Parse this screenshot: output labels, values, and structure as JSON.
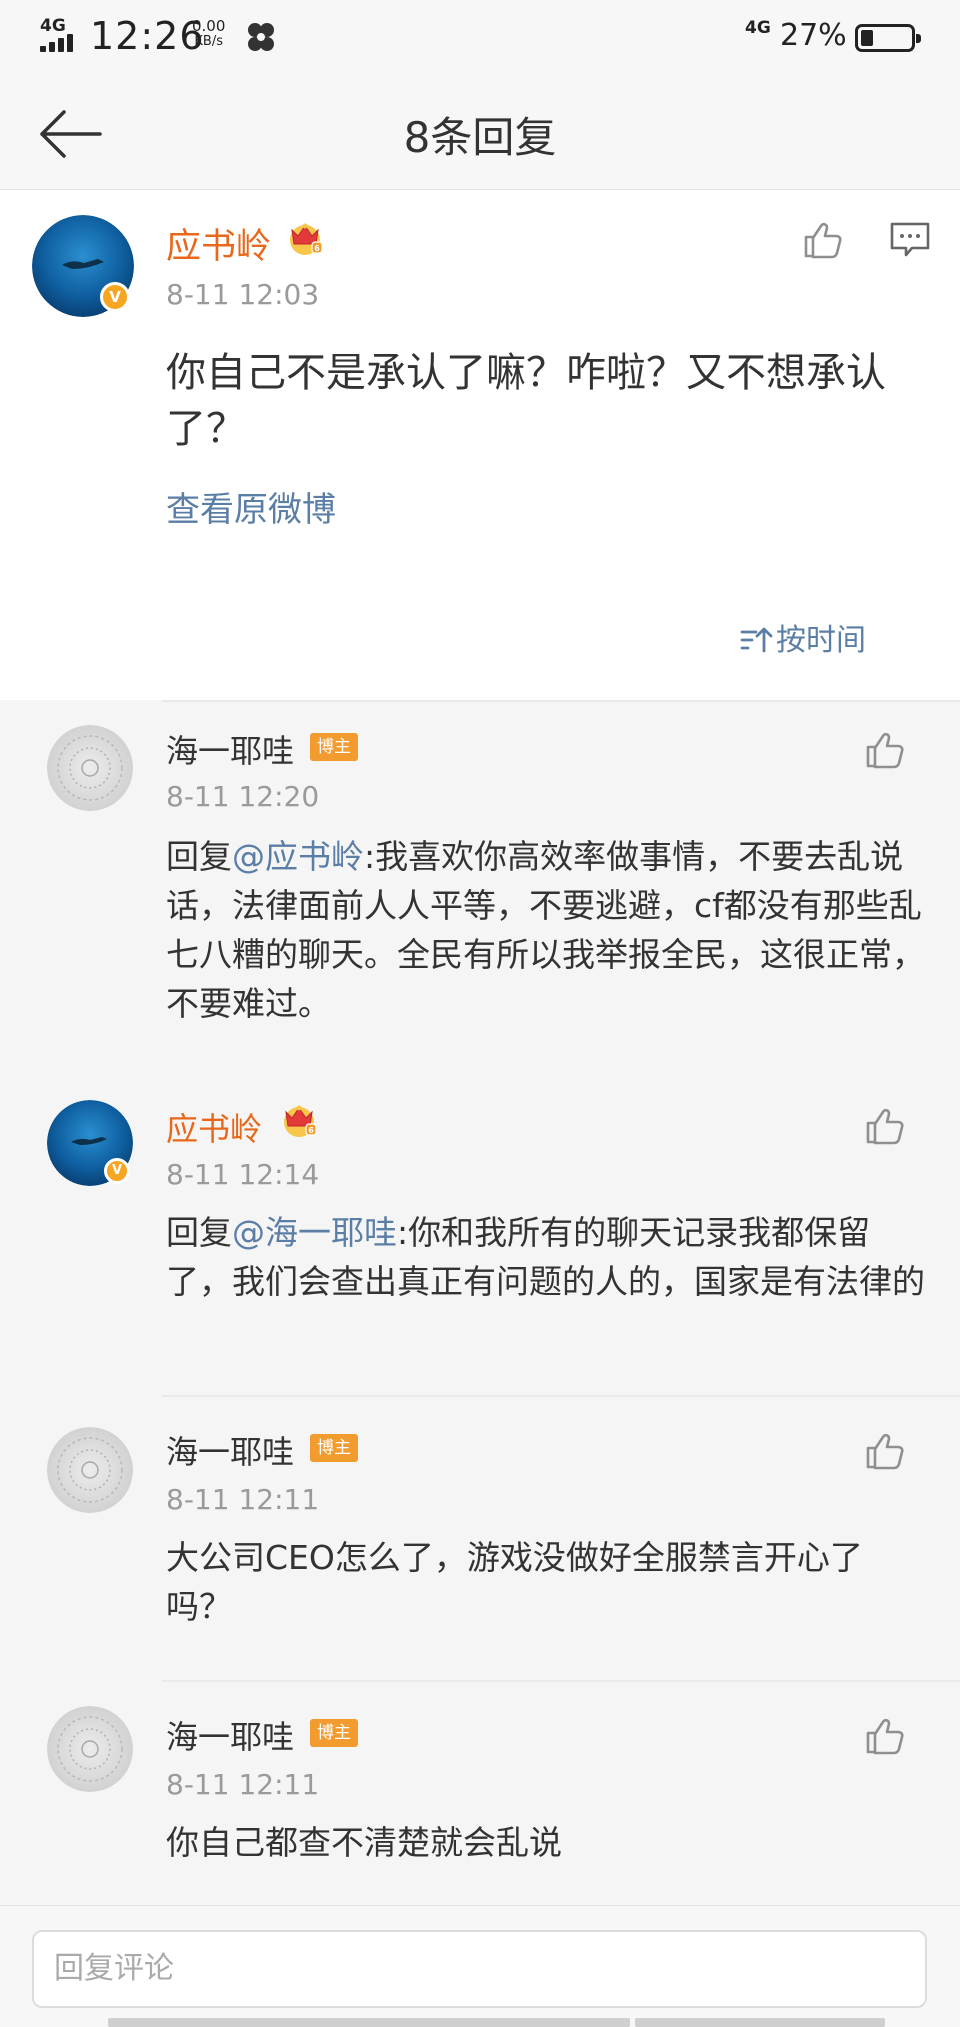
{
  "status_bar": {
    "network_left": "4G",
    "time": "12:26",
    "speed_value": "0.00",
    "speed_unit": "KB/s",
    "network_right": "4G",
    "battery_percent": "27%",
    "battery_level": 0.27
  },
  "header": {
    "title": "8条回复"
  },
  "main_comment": {
    "author": "应书岭",
    "verified_badge": "V",
    "time": "8-11 12:03",
    "text": "你自己不是承认了嘛？咋啦？又不想承认了？",
    "view_original": "查看原微博",
    "sort_label": "按时间"
  },
  "replies": [
    {
      "author": "海一耶哇",
      "tag": "博主",
      "time": "8-11 12:20",
      "prefix": "回复",
      "mention": "@应书岭",
      "text": ":我喜欢你高效率做事情，不要去乱说话，法律面前人人平等，不要逃避，cf都没有那些乱七八糟的聊天。全民有所以我举报全民，这很正常，不要难过。"
    },
    {
      "author": "应书岭",
      "verified_badge": "V",
      "time": "8-11 12:14",
      "prefix": "回复",
      "mention": "@海一耶哇",
      "text": ":你和我所有的聊天记录我都保留了，我们会查出真正有问题的人的，国家是有法律的"
    },
    {
      "author": "海一耶哇",
      "tag": "博主",
      "time": "8-11 12:11",
      "text": "大公司CEO怎么了，游戏没做好全服禁言开心了吗？"
    },
    {
      "author": "海一耶哇",
      "tag": "博主",
      "time": "8-11 12:11",
      "text": "你自己都查不清楚就会乱说"
    }
  ],
  "bottom": {
    "input_placeholder": "回复评论"
  },
  "colors": {
    "vip_name": "#e8671b",
    "link": "#5b7ea6",
    "blogger_tag": "#f29b2f",
    "verified": "#f6a623"
  }
}
